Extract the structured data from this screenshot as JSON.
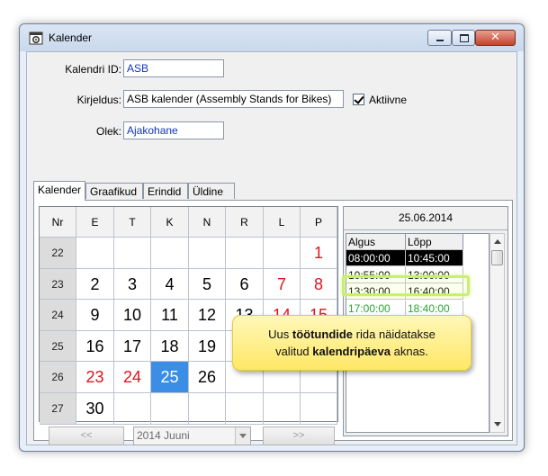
{
  "window": {
    "title": "Kalender",
    "icon": "calendar-gear-icon",
    "controls": {
      "minimize": "minimize-icon",
      "maximize": "maximize-icon",
      "close": "✕"
    }
  },
  "form": {
    "calendar_id_label": "Kalendri ID:",
    "calendar_id_value": "ASB",
    "description_label": "Kirjeldus:",
    "description_value": "ASB kalender (Assembly Stands for Bikes)",
    "active_label": "Aktiivne",
    "active_checked": true,
    "state_label": "Olek:",
    "state_value": "Ajakohane"
  },
  "tabs": [
    "Kalender",
    "Graafikud",
    "Erindid",
    "Üldine"
  ],
  "calendar": {
    "headers": [
      "Nr",
      "E",
      "T",
      "K",
      "N",
      "R",
      "L",
      "P"
    ],
    "weeks": [
      {
        "nr": "22",
        "days": [
          "",
          "",
          "",
          "",
          "",
          "",
          "1"
        ]
      },
      {
        "nr": "23",
        "days": [
          "2",
          "3",
          "4",
          "5",
          "6",
          "7",
          "8"
        ]
      },
      {
        "nr": "24",
        "days": [
          "9",
          "10",
          "11",
          "12",
          "13",
          "14",
          "15"
        ]
      },
      {
        "nr": "25",
        "days": [
          "16",
          "17",
          "18",
          "19",
          "",
          "",
          ""
        ]
      },
      {
        "nr": "26",
        "days": [
          "23",
          "24",
          "25",
          "26",
          "",
          "",
          ""
        ]
      },
      {
        "nr": "27",
        "days": [
          "30",
          "",
          "",
          "",
          "",
          "",
          ""
        ]
      }
    ],
    "red_days": [
      "1",
      "7",
      "8",
      "14",
      "15",
      "23",
      "24"
    ],
    "selected_day": "25",
    "selected_color": "#3a8ee6",
    "holiday_color": "#e0141e"
  },
  "calendar_nav": {
    "prev_label": "<<",
    "month_value": "2014 Juuni",
    "next_label": ">>"
  },
  "schedule": {
    "date": "25.06.2014",
    "col_start": "Algus",
    "col_end": "Lõpp",
    "rows": [
      {
        "start": "08:00:00",
        "end": "10:45:00",
        "selected": true
      },
      {
        "start": "10:55:00",
        "end": "13:00:00"
      },
      {
        "start": "13:30:00",
        "end": "16:40:00"
      },
      {
        "start": "17:00:00",
        "end": "18:40:00",
        "new": true
      }
    ],
    "new_row_color": "#27a82f"
  },
  "callout": {
    "part1": "Uus ",
    "bold1": "töötundide",
    "part2": " rida näidatakse",
    "part3": "valitud ",
    "bold2": "kalendripäeva",
    "part4": " aknas."
  }
}
